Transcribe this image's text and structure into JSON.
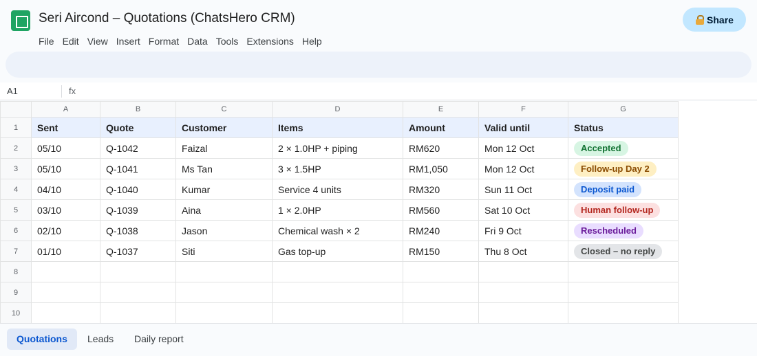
{
  "app": {
    "title": "Seri Aircond – Quotations (ChatsHero CRM)",
    "share_label": "Share",
    "accent_color": "#1fa463"
  },
  "menu": [
    "File",
    "Edit",
    "View",
    "Insert",
    "Format",
    "Data",
    "Tools",
    "Extensions",
    "Help"
  ],
  "formula_bar": {
    "cell_ref": "A1",
    "fx_label": "fx",
    "value": ""
  },
  "sheet": {
    "column_letters": [
      "A",
      "B",
      "C",
      "D",
      "E",
      "F",
      "G"
    ],
    "row_numbers": [
      "1",
      "2",
      "3",
      "4",
      "5",
      "6",
      "7",
      "8",
      "9",
      "10"
    ],
    "headers": [
      "Sent",
      "Quote",
      "Customer",
      "Items",
      "Amount",
      "Valid until",
      "Status"
    ],
    "rows": [
      [
        "05/10",
        "Q-1042",
        "Faizal",
        "2 × 1.0HP + piping",
        "RM620",
        "Mon 12 Oct",
        "Accepted"
      ],
      [
        "05/10",
        "Q-1041",
        "Ms Tan",
        "3 × 1.5HP",
        "RM1,050",
        "Mon 12 Oct",
        "Follow-up Day 2"
      ],
      [
        "04/10",
        "Q-1040",
        "Kumar",
        "Service 4 units",
        "RM320",
        "Sun 11 Oct",
        "Deposit paid"
      ],
      [
        "03/10",
        "Q-1039",
        "Aina",
        "1 × 2.0HP",
        "RM560",
        "Sat 10 Oct",
        "Human follow-up"
      ],
      [
        "02/10",
        "Q-1038",
        "Jason",
        "Chemical wash × 2",
        "RM240",
        "Fri 9 Oct",
        "Rescheduled"
      ],
      [
        "01/10",
        "Q-1037",
        "Siti",
        "Gas top-up",
        "RM150",
        "Thu 8 Oct",
        "Closed – no reply"
      ]
    ],
    "status_colors": {
      "Accepted": {
        "bg": "#d7f5e3",
        "fg": "#137333"
      },
      "Follow-up Day 2": {
        "bg": "#feefc3",
        "fg": "#8a4b00"
      },
      "Deposit paid": {
        "bg": "#d3e3fd",
        "fg": "#0b57d0"
      },
      "Human follow-up": {
        "bg": "#fce0e0",
        "fg": "#b3261e"
      },
      "Rescheduled": {
        "bg": "#e9ddff",
        "fg": "#6a1b9a"
      },
      "Closed – no reply": {
        "bg": "#e3e5e8",
        "fg": "#444746"
      }
    }
  },
  "tabs": [
    {
      "label": "Quotations",
      "active": true
    },
    {
      "label": "Leads",
      "active": false
    },
    {
      "label": "Daily report",
      "active": false
    }
  ]
}
